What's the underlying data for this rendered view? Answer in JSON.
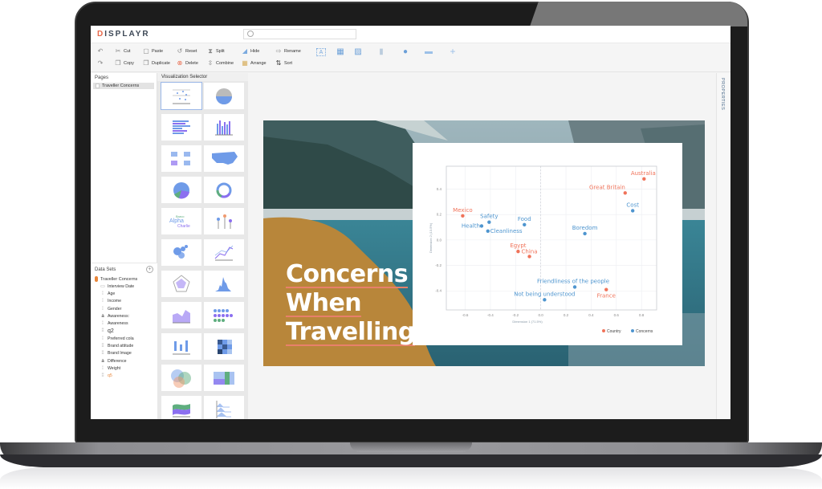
{
  "app": {
    "logo": "DISPLAYR",
    "search_placeholder": ""
  },
  "toolbar": {
    "row1": [
      "Cut",
      "Paste",
      "Reset",
      "Split",
      "Hide",
      "Rename"
    ],
    "row2": [
      "Copy",
      "Duplicate",
      "Delete",
      "Combine",
      "Arrange",
      "Sort"
    ],
    "insert_icons": [
      "text-box-icon",
      "table-icon",
      "image-icon",
      "chart-icon",
      "shape-icon",
      "line-icon",
      "add-icon"
    ]
  },
  "pages": {
    "title": "Pages",
    "items": [
      {
        "label": "Traveller Concerns"
      }
    ]
  },
  "datasets": {
    "title": "Data Sets",
    "root": "Traveller Concerns",
    "items": [
      {
        "label": "Interview Date",
        "icon": "date"
      },
      {
        "label": "Age",
        "icon": "ordinal"
      },
      {
        "label": "Income",
        "icon": "ordinal"
      },
      {
        "label": "Gender",
        "icon": "ordinal"
      },
      {
        "label": "Awareness:",
        "icon": "text"
      },
      {
        "label": "Awareness",
        "icon": "ordinal"
      },
      {
        "label": "q2",
        "icon": "grid"
      },
      {
        "label": "Preferred cola",
        "icon": "ordinal"
      },
      {
        "label": "Brand attitude",
        "icon": "grid"
      },
      {
        "label": "Brand Image",
        "icon": "grid"
      },
      {
        "label": "Difference",
        "icon": "text"
      },
      {
        "label": "Weight",
        "icon": "ordinal"
      },
      {
        "label": "q5",
        "icon": "grid",
        "highlight": true
      }
    ]
  },
  "viz_selector": {
    "title": "Visualization Selector",
    "items": [
      "scatter",
      "pictograph",
      "bar",
      "column",
      "small-multiples-bar",
      "geographic-map",
      "pie",
      "donut",
      "word-cloud",
      "pictograph-column",
      "bubble",
      "line",
      "radar",
      "histogram",
      "area",
      "dot-plot",
      "box-plot",
      "heatmap",
      "venn",
      "mosaic",
      "stream",
      "ridgeline"
    ]
  },
  "properties": {
    "label": "PROPERTIES"
  },
  "slide": {
    "title_lines": [
      "Concerns",
      "When",
      "Travelling"
    ],
    "accent": "#b8863a",
    "underline": "#e8806a"
  },
  "chart_data": {
    "type": "scatter",
    "title": "",
    "xlabel": "Dimension 1 (71.5%)",
    "ylabel": "Dimension 2 (13.5%)",
    "xlim": [
      -0.75,
      0.92
    ],
    "ylim": [
      -0.55,
      0.58
    ],
    "xticks": [
      -0.6,
      -0.4,
      -0.2,
      0.0,
      0.2,
      0.4,
      0.6,
      0.8
    ],
    "xtick_labels": [
      "-0.6",
      "-0.4",
      "-0.2",
      "0.0",
      "0.2",
      "0.4",
      "0.6",
      "0.8"
    ],
    "yticks": [
      0.4,
      0.2,
      0.0,
      -0.2,
      -0.4
    ],
    "ytick_labels": [
      "0.4",
      "0.2",
      "0.0",
      "-0.2",
      "-0.4"
    ],
    "grid": true,
    "legend_position": "bottom-right",
    "series": [
      {
        "name": "Country",
        "color": "#f0735a",
        "points": [
          {
            "label": "Mexico",
            "x": -0.62,
            "y": 0.19
          },
          {
            "label": "Australia",
            "x": 0.82,
            "y": 0.48
          },
          {
            "label": "Great Britain",
            "x": 0.67,
            "y": 0.37
          },
          {
            "label": "Egypt",
            "x": -0.18,
            "y": -0.09
          },
          {
            "label": "China",
            "x": -0.09,
            "y": -0.13
          },
          {
            "label": "France",
            "x": 0.52,
            "y": -0.39
          }
        ]
      },
      {
        "name": "Concerns",
        "color": "#4e95cf",
        "points": [
          {
            "label": "Safety",
            "x": -0.41,
            "y": 0.14
          },
          {
            "label": "Health",
            "x": -0.47,
            "y": 0.11
          },
          {
            "label": "Cleanliness",
            "x": -0.42,
            "y": 0.07
          },
          {
            "label": "Food",
            "x": -0.13,
            "y": 0.12
          },
          {
            "label": "Boredom",
            "x": 0.35,
            "y": 0.05
          },
          {
            "label": "Cost",
            "x": 0.73,
            "y": 0.23
          },
          {
            "label": "Friendliness of the people",
            "x": 0.27,
            "y": -0.37
          },
          {
            "label": "Not being understood",
            "x": 0.03,
            "y": -0.47
          }
        ]
      }
    ]
  }
}
